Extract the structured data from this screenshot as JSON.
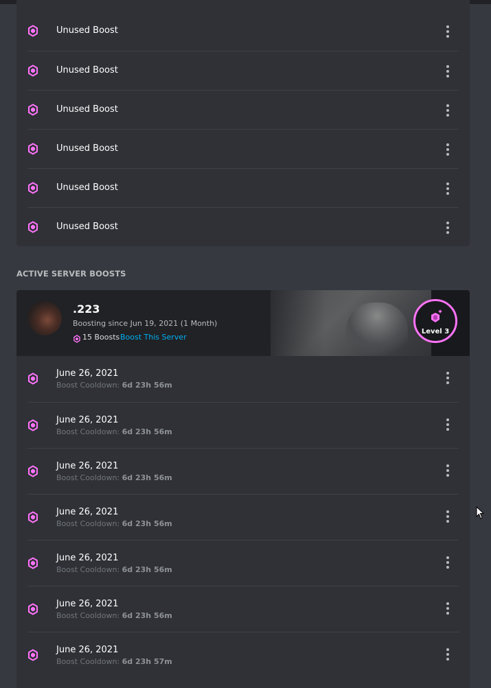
{
  "colors": {
    "background": "#36393f",
    "panel": "#2f3136",
    "header": "#202225",
    "boost_pink": "#ff73fa",
    "link_blue": "#00aff4"
  },
  "unused_boosts": {
    "icon": "boost-gem-icon",
    "items": [
      {
        "label": "Unused Boost"
      },
      {
        "label": "Unused Boost"
      },
      {
        "label": "Unused Boost"
      },
      {
        "label": "Unused Boost"
      },
      {
        "label": "Unused Boost"
      },
      {
        "label": "Unused Boost"
      }
    ]
  },
  "active_section": {
    "title": "ACTIVE SERVER BOOSTS"
  },
  "server": {
    "name": ".223",
    "boosting_since": "Boosting since Jun 19, 2021 (1 Month)",
    "boost_count": "15 Boosts",
    "boost_link": "Boost This Server",
    "level": "Level 3"
  },
  "active_boosts": {
    "cooldown_label": "Boost Cooldown:",
    "items": [
      {
        "date": "June 26, 2021",
        "cooldown": "6d 23h 56m"
      },
      {
        "date": "June 26, 2021",
        "cooldown": "6d 23h 56m"
      },
      {
        "date": "June 26, 2021",
        "cooldown": "6d 23h 56m"
      },
      {
        "date": "June 26, 2021",
        "cooldown": "6d 23h 56m"
      },
      {
        "date": "June 26, 2021",
        "cooldown": "6d 23h 56m"
      },
      {
        "date": "June 26, 2021",
        "cooldown": "6d 23h 56m"
      },
      {
        "date": "June 26, 2021",
        "cooldown": "6d 23h 57m"
      }
    ]
  }
}
